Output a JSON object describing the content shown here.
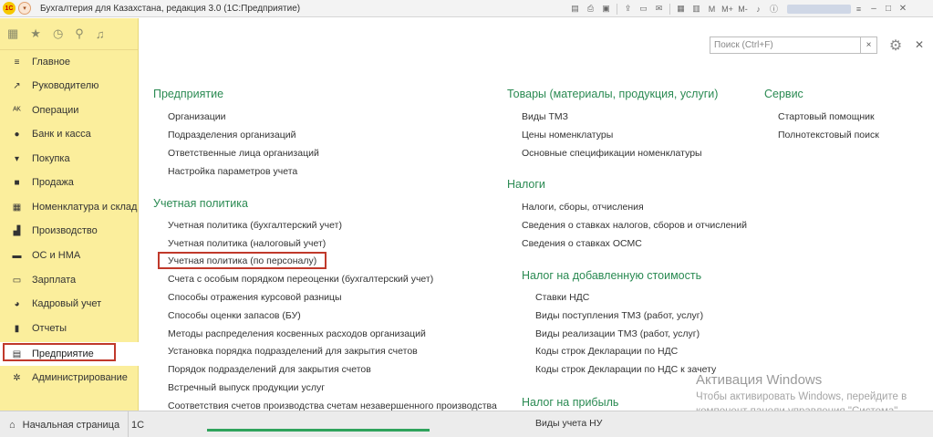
{
  "titlebar": {
    "logo": "1С",
    "title": "Бухгалтерия для Казахстана, редакция 3.0  (1С:Предприятие)",
    "tools": [
      "M",
      "M+",
      "M-"
    ]
  },
  "sidebar": {
    "items": [
      {
        "label": "Главное",
        "icon": "menu-icon",
        "glyph": "≡"
      },
      {
        "label": "Руководителю",
        "icon": "trend-icon",
        "glyph": "↗"
      },
      {
        "label": "Операции",
        "icon": "operations-icon",
        "glyph": "ᴬᴷ"
      },
      {
        "label": "Банк и касса",
        "icon": "bank-icon",
        "glyph": "●"
      },
      {
        "label": "Покупка",
        "icon": "cart-icon",
        "glyph": "▾"
      },
      {
        "label": "Продажа",
        "icon": "bag-icon",
        "glyph": "■"
      },
      {
        "label": "Номенклатура и склад",
        "icon": "warehouse-icon",
        "glyph": "▦"
      },
      {
        "label": "Производство",
        "icon": "factory-icon",
        "glyph": "▟"
      },
      {
        "label": "ОС и НМА",
        "icon": "truck-icon",
        "glyph": "▬"
      },
      {
        "label": "Зарплата",
        "icon": "salary-icon",
        "glyph": "▭"
      },
      {
        "label": "Кадровый учет",
        "icon": "personnel-icon",
        "glyph": "◕"
      },
      {
        "label": "Отчеты",
        "icon": "reports-icon",
        "glyph": "▮"
      },
      {
        "label": "Предприятие",
        "icon": "enterprise-icon",
        "glyph": "▤"
      },
      {
        "label": "Администрирование",
        "icon": "gear-icon",
        "glyph": "✲"
      }
    ]
  },
  "bottombar": {
    "home_label": "Начальная страница",
    "next_tab_fragment": "1С"
  },
  "search": {
    "placeholder": "Поиск (Ctrl+F)",
    "clear": "×"
  },
  "sections": {
    "enterprise": {
      "title": "Предприятие",
      "links": [
        "Организации",
        "Подразделения организаций",
        "Ответственные лица организаций",
        "Настройка параметров учета"
      ]
    },
    "accounting_policy": {
      "title": "Учетная политика",
      "links": [
        "Учетная политика (бухгалтерский учет)",
        "Учетная политика (налоговый учет)",
        "Учетная политика (по персоналу)",
        "Счета с особым порядком переоценки (бухгалтерский учет)",
        "Способы отражения курсовой разницы",
        "Способы оценки запасов (БУ)",
        "Методы распределения косвенных расходов организаций",
        "Установка порядка подразделений для закрытия счетов",
        "Порядок подразделений для закрытия счетов",
        "Встречный выпуск продукции услуг",
        "Соответствия счетов производства счетам незавершенного производства"
      ]
    },
    "goods": {
      "title": "Товары (материалы, продукция, услуги)",
      "links": [
        "Виды ТМЗ",
        "Цены номенклатуры",
        "Основные спецификации номенклатуры"
      ]
    },
    "taxes": {
      "title": "Налоги",
      "links": [
        "Налоги, сборы, отчисления",
        "Сведения о ставках налогов, сборов и отчислений",
        "Сведения о ставках ОСМС"
      ]
    },
    "vat": {
      "title": "Налог на добавленную стоимость",
      "links": [
        "Ставки НДС",
        "Виды поступления ТМЗ (работ, услуг)",
        "Виды реализации ТМЗ (работ, услуг)",
        "Коды строк Декларации по НДС",
        "Коды строк Декларации по НДС к зачету"
      ]
    },
    "profit_tax": {
      "title": "Налог на прибыль",
      "links": [
        "Виды учета НУ"
      ]
    },
    "service": {
      "title": "Сервис",
      "links": [
        "Стартовый помощник",
        "Полнотекстовый поиск"
      ]
    }
  },
  "watermark": {
    "title": "Активация Windows",
    "line1": "Чтобы активировать Windows, перейдите в",
    "line2": "компонент панели управления \"Система\"."
  }
}
